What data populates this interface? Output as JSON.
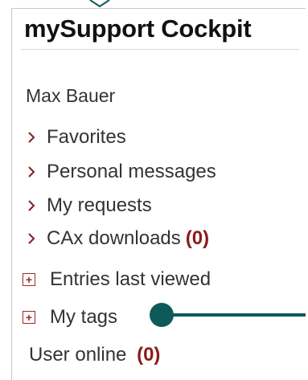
{
  "panel": {
    "title": "mySupport Cockpit",
    "user_name": "Max Bauer",
    "nav_items": [
      {
        "label": "Favorites",
        "count": ""
      },
      {
        "label": "Personal messages",
        "count": ""
      },
      {
        "label": "My requests",
        "count": ""
      },
      {
        "label": "CAx downloads",
        "count": "(0)"
      }
    ],
    "expand_items": [
      {
        "label": "Entries last viewed",
        "icon": "plus-box-icon"
      },
      {
        "label": "My tags",
        "icon": "plus-box-icon"
      }
    ],
    "online": {
      "label": "User online",
      "count": "(0)"
    }
  },
  "colors": {
    "accent_red": "#8b1a1a",
    "pointer_teal": "#0e5a5a",
    "text": "#333333"
  }
}
